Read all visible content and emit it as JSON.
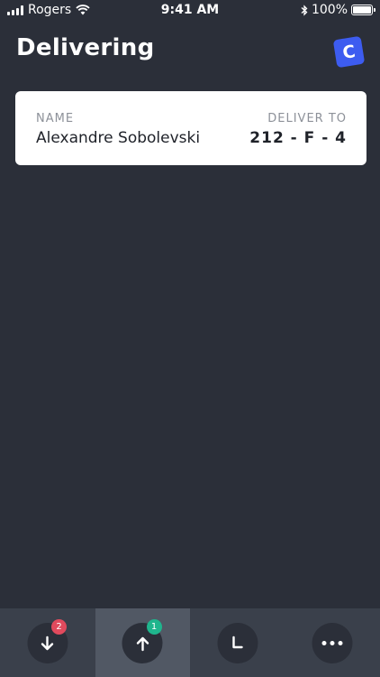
{
  "status_bar": {
    "carrier": "Rogers",
    "time": "9:41 AM",
    "battery": "100%",
    "battery_level": 1.0
  },
  "header": {
    "title": "Delivering",
    "logo_letter": "C"
  },
  "delivery": {
    "name_label": "NAME",
    "name_value": "Alexandre Sobolevski",
    "deliver_label": "DELIVER TO",
    "deliver_value": "212 - F - 4"
  },
  "tab_bar": {
    "tabs": [
      {
        "icon": "arrow-down-icon",
        "badge": "2",
        "badge_color": "#e14a5d",
        "active": false
      },
      {
        "icon": "arrow-up-icon",
        "badge": "1",
        "badge_color": "#1fb58d",
        "active": true
      },
      {
        "icon": "clock-icon",
        "badge": "",
        "active": false
      },
      {
        "icon": "more-icon",
        "badge": "",
        "active": false
      }
    ]
  },
  "colors": {
    "background": "#2b2f39",
    "tab_bar": "#3a404b",
    "tab_active": "#515864",
    "brand": "#3d5cf0"
  }
}
